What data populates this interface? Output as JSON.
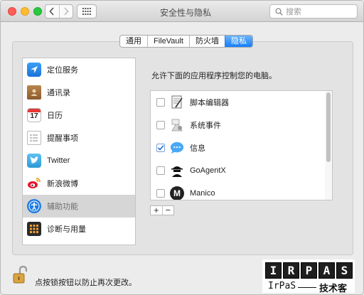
{
  "window": {
    "title": "安全性与隐私"
  },
  "search": {
    "placeholder": "搜索"
  },
  "tabs": [
    {
      "label": "通用",
      "active": false
    },
    {
      "label": "FileVault",
      "active": false
    },
    {
      "label": "防火墙",
      "active": false
    },
    {
      "label": "隐私",
      "active": true
    }
  ],
  "sidebar": {
    "items": [
      {
        "label": "定位服务",
        "icon": "location-icon"
      },
      {
        "label": "通讯录",
        "icon": "contacts-icon"
      },
      {
        "label": "日历",
        "icon": "calendar-icon",
        "icon_text": "17"
      },
      {
        "label": "提醒事项",
        "icon": "reminders-icon"
      },
      {
        "label": "Twitter",
        "icon": "twitter-icon"
      },
      {
        "label": "新浪微博",
        "icon": "weibo-icon"
      },
      {
        "label": "辅助功能",
        "icon": "accessibility-icon",
        "selected": true
      },
      {
        "label": "诊断与用量",
        "icon": "diagnostics-icon"
      }
    ]
  },
  "main": {
    "heading": "允许下面的应用程序控制您的电脑。",
    "apps": [
      {
        "name": "脚本编辑器",
        "checked": false,
        "icon": "script-editor-icon"
      },
      {
        "name": "系统事件",
        "checked": false,
        "icon": "system-events-icon"
      },
      {
        "name": "信息",
        "checked": true,
        "icon": "messages-icon"
      },
      {
        "name": "GoAgentX",
        "checked": false,
        "icon": "goagentx-icon"
      },
      {
        "name": "Manico",
        "checked": false,
        "icon": "manico-icon",
        "icon_text": "M"
      }
    ],
    "add_label": "+",
    "remove_label": "−"
  },
  "footer": {
    "lock_text": "点按锁按钮以防止再次更改。"
  },
  "watermark": {
    "letters": [
      "I",
      "R",
      "P",
      "A",
      "S"
    ],
    "sub_left": "IrPaS",
    "sub_right": "技术客"
  },
  "colors": {
    "accent": "#167efb",
    "selection": "#d6d6d6"
  }
}
